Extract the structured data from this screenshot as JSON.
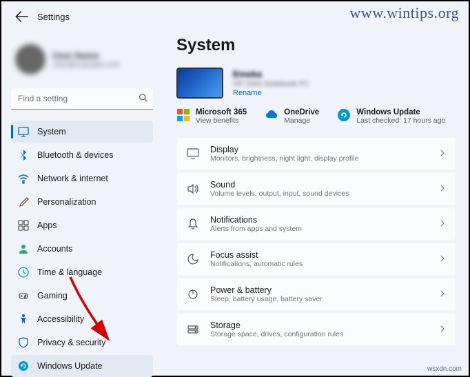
{
  "header": {
    "title": "Settings"
  },
  "user": {
    "name": "User Name",
    "email": "user@example.com"
  },
  "search": {
    "placeholder": "Find a setting"
  },
  "sidebar": {
    "items": [
      {
        "label": "System"
      },
      {
        "label": "Bluetooth & devices"
      },
      {
        "label": "Network & internet"
      },
      {
        "label": "Personalization"
      },
      {
        "label": "Apps"
      },
      {
        "label": "Accounts"
      },
      {
        "label": "Time & language"
      },
      {
        "label": "Gaming"
      },
      {
        "label": "Accessibility"
      },
      {
        "label": "Privacy & security"
      },
      {
        "label": "Windows Update"
      }
    ]
  },
  "main": {
    "title": "System",
    "device": {
      "name": "Emeka",
      "model": "HP 2000 Notebook PC",
      "rename": "Rename"
    },
    "services": [
      {
        "title": "Microsoft 365",
        "sub": "View benefits"
      },
      {
        "title": "OneDrive",
        "sub": "Manage"
      },
      {
        "title": "Windows Update",
        "sub": "Last checked: 17 hours ago"
      }
    ],
    "settings": [
      {
        "title": "Display",
        "sub": "Monitors, brightness, night light, display profile"
      },
      {
        "title": "Sound",
        "sub": "Volume levels, output, input, sound devices"
      },
      {
        "title": "Notifications",
        "sub": "Alerts from apps and system"
      },
      {
        "title": "Focus assist",
        "sub": "Notifications, automatic rules"
      },
      {
        "title": "Power & battery",
        "sub": "Sleep, battery usage, battery saver"
      },
      {
        "title": "Storage",
        "sub": "Storage space, drives, configuration rules"
      }
    ]
  },
  "watermarks": {
    "top": "www.wintips.org",
    "bottom": "wsxdn.com"
  }
}
